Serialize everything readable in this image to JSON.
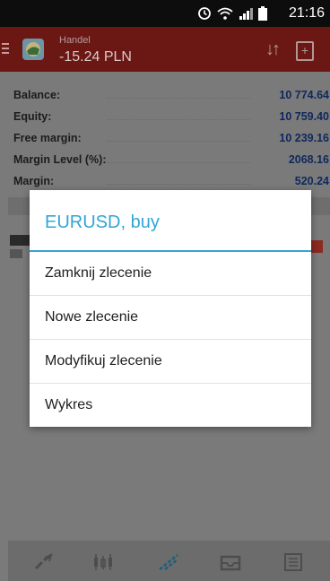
{
  "status_bar": {
    "time": "21:16"
  },
  "app_bar": {
    "subtitle": "Handel",
    "title": "-15.24 PLN"
  },
  "account": [
    {
      "label": "Balance:",
      "value": "10 774.64"
    },
    {
      "label": "Equity:",
      "value": "10 759.40"
    },
    {
      "label": "Free margin:",
      "value": "10 239.16"
    },
    {
      "label": "Margin Level (%):",
      "value": "2068.16"
    },
    {
      "label": "Margin:",
      "value": "520.24"
    }
  ],
  "dialog": {
    "title": "EURUSD, buy",
    "items": [
      {
        "label": "Zamknij zlecenie"
      },
      {
        "label": "Nowe zlecenie"
      },
      {
        "label": "Modyfikuj zlecenie"
      },
      {
        "label": "Wykres"
      }
    ]
  },
  "colors": {
    "accent": "#31a6d6",
    "appbar": "#6b1814",
    "value_text": "#10285c"
  }
}
